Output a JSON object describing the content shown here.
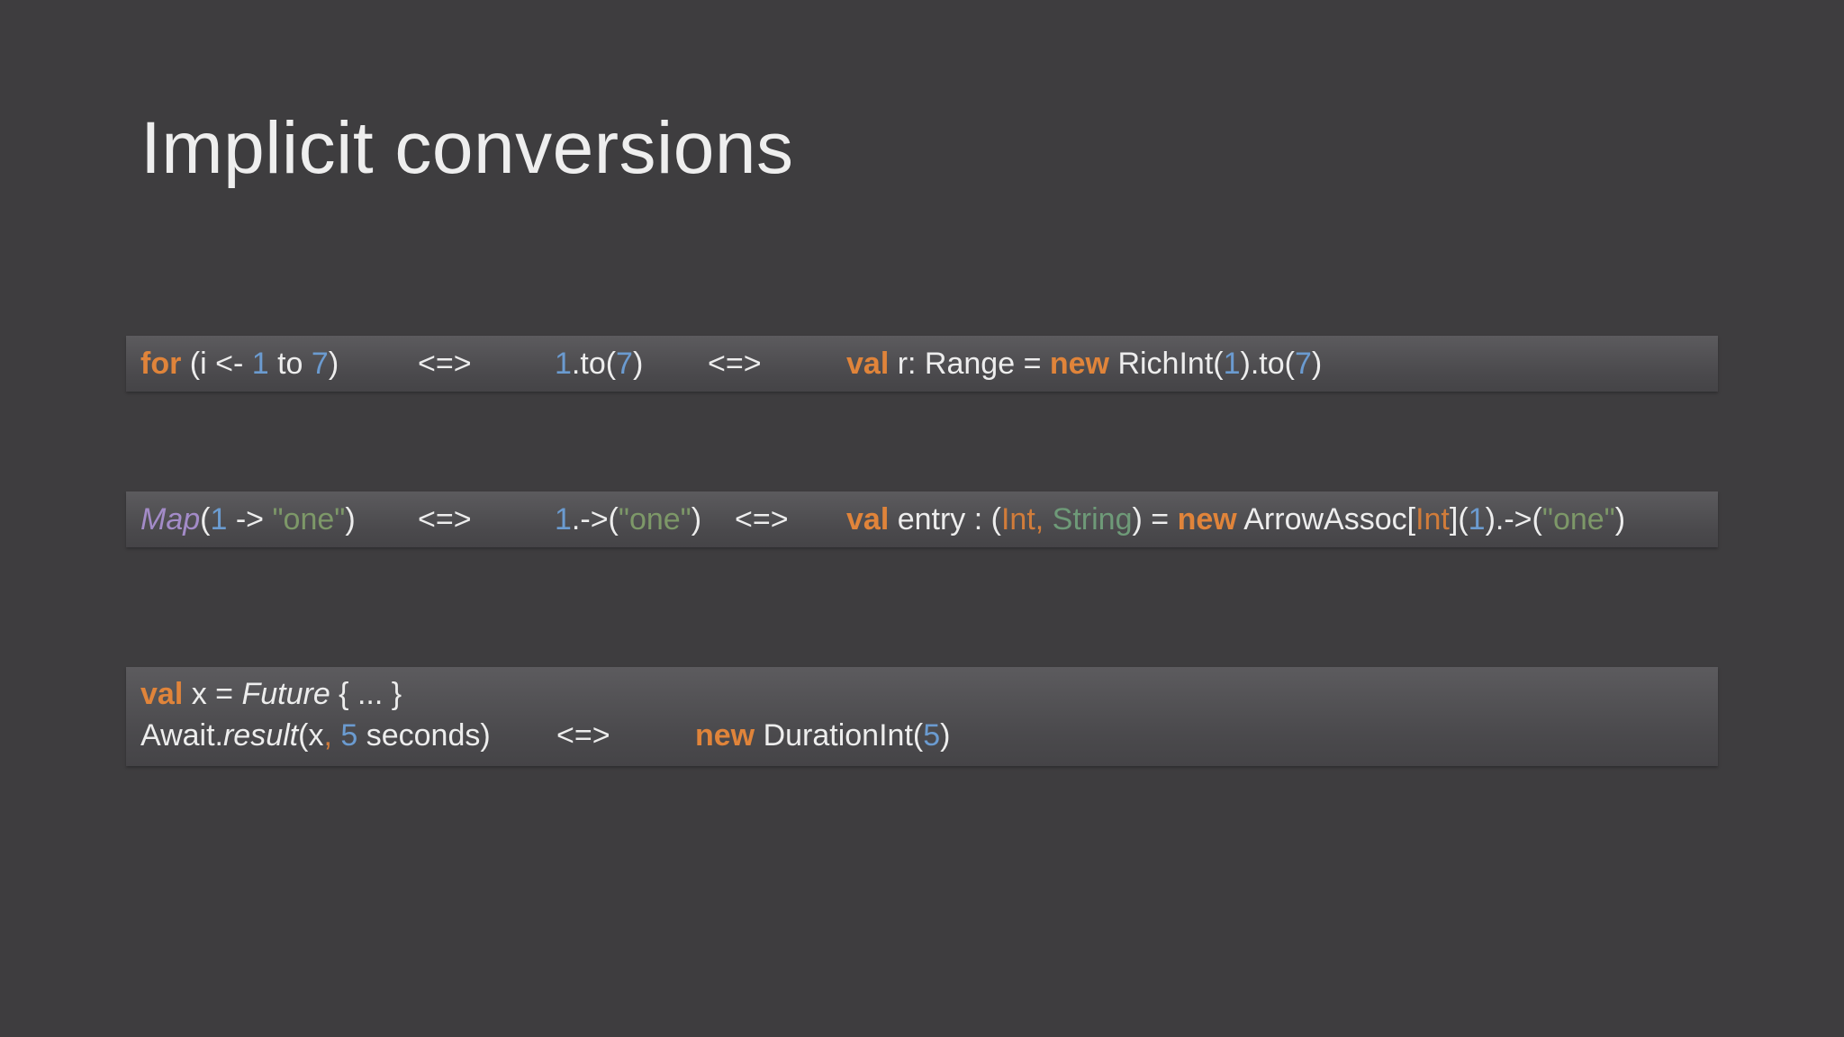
{
  "slide": {
    "title": "Implicit conversions"
  },
  "rows": [
    {
      "segments": [
        [
          {
            "t": "for",
            "c": "kw"
          },
          {
            "t": " (i <- ",
            "c": "plain"
          },
          {
            "t": "1",
            "c": "num"
          },
          {
            "t": " to ",
            "c": "plain"
          },
          {
            "t": "7",
            "c": "num"
          },
          {
            "t": ")",
            "c": "plain"
          }
        ],
        [
          {
            "t": "<=>",
            "c": "plain"
          }
        ],
        [
          {
            "t": "1",
            "c": "num"
          },
          {
            "t": ".to(",
            "c": "plain"
          },
          {
            "t": "7",
            "c": "num"
          },
          {
            "t": ")",
            "c": "plain"
          }
        ],
        [
          {
            "t": "<=>",
            "c": "plain"
          }
        ],
        [
          {
            "t": "val",
            "c": "kw"
          },
          {
            "t": " r: Range = ",
            "c": "plain"
          },
          {
            "t": "new",
            "c": "kw"
          },
          {
            "t": " RichInt(",
            "c": "plain"
          },
          {
            "t": "1",
            "c": "num"
          },
          {
            "t": ").to(",
            "c": "plain"
          },
          {
            "t": "7",
            "c": "num"
          },
          {
            "t": ")",
            "c": "plain"
          }
        ]
      ]
    },
    {
      "segments": [
        [
          {
            "t": "Map",
            "c": "typ"
          },
          {
            "t": "(",
            "c": "plain"
          },
          {
            "t": "1",
            "c": "num"
          },
          {
            "t": " -> ",
            "c": "plain"
          },
          {
            "t": "\"one\"",
            "c": "str"
          },
          {
            "t": ")",
            "c": "plain"
          }
        ],
        [
          {
            "t": "<=>",
            "c": "plain"
          }
        ],
        [
          {
            "t": "1",
            "c": "num"
          },
          {
            "t": ".->(",
            "c": "plain"
          },
          {
            "t": "\"one\"",
            "c": "str"
          },
          {
            "t": ")",
            "c": "plain"
          }
        ],
        [
          {
            "t": "<=>",
            "c": "plain"
          }
        ],
        [
          {
            "t": "val",
            "c": "kw"
          },
          {
            "t": " entry : (",
            "c": "plain"
          },
          {
            "t": "Int,",
            "c": "typ-int"
          },
          {
            "t": " String",
            "c": "typ-str"
          },
          {
            "t": ") = ",
            "c": "plain"
          },
          {
            "t": "new",
            "c": "kw"
          },
          {
            "t": " ArrowAssoc[",
            "c": "plain"
          },
          {
            "t": "Int",
            "c": "typ-int"
          },
          {
            "t": "](",
            "c": "plain"
          },
          {
            "t": "1",
            "c": "num"
          },
          {
            "t": ").->(",
            "c": "plain"
          },
          {
            "t": "\"one\"",
            "c": "str"
          },
          {
            "t": ")",
            "c": "plain"
          }
        ]
      ]
    },
    {
      "line1": [
        {
          "t": "val",
          "c": "kw"
        },
        {
          "t": " x = ",
          "c": "plain"
        },
        {
          "t": "Future",
          "c": "it plain"
        },
        {
          "t": " { ... }",
          "c": "plain"
        }
      ],
      "segments": [
        [
          {
            "t": "Await.",
            "c": "plain"
          },
          {
            "t": "result",
            "c": "it plain"
          },
          {
            "t": "(x",
            "c": "plain"
          },
          {
            "t": ",",
            "c": "typ-int"
          },
          {
            "t": " 5",
            "c": "num"
          },
          {
            "t": " seconds)",
            "c": "plain"
          }
        ],
        [
          {
            "t": "<=>",
            "c": "plain"
          }
        ],
        [
          {
            "t": "new",
            "c": "kw"
          },
          {
            "t": " DurationInt(",
            "c": "plain"
          },
          {
            "t": "5",
            "c": "num"
          },
          {
            "t": ")",
            "c": "plain"
          }
        ]
      ]
    }
  ]
}
